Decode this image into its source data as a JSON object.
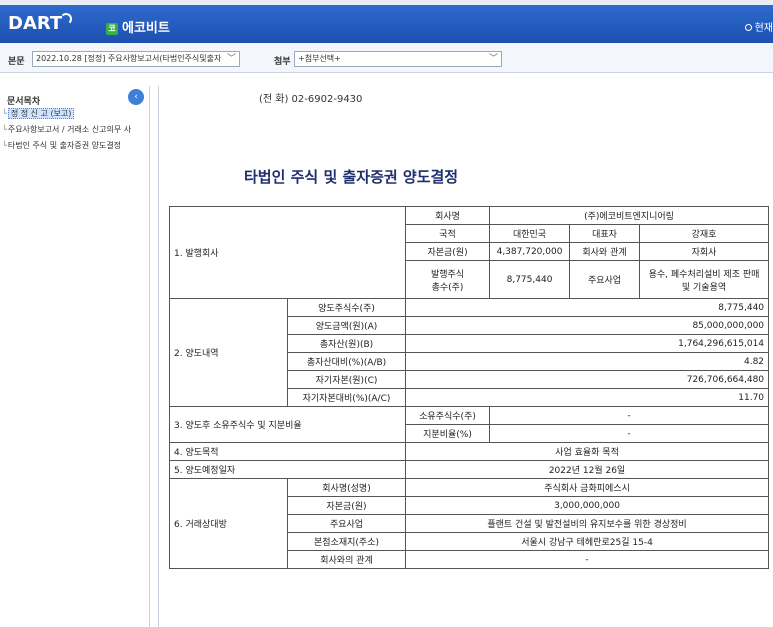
{
  "header": {
    "logo": "DART",
    "company_badge": "코",
    "company": "에코비트",
    "now": "현재"
  },
  "selbar": {
    "body_label": "본문",
    "body_value": "2022.10.28 [정정] 주요사항보고서(타법인주식및출자",
    "attach_label": "첨부",
    "attach_value": "+첨부선택+"
  },
  "sidebar": {
    "title": "문서목차",
    "items": [
      {
        "label": "정 정 신 고 (보고)"
      },
      {
        "label": "주요사항보고서 / 거래소 신고의무 사"
      },
      {
        "label": "타법인 주식 및 출자증권 양도결정"
      }
    ]
  },
  "doc": {
    "phone": "(전  화)  02-6902-9430",
    "title": "타법인 주식 및 출자증권 양도결정",
    "issuer": {
      "section": "1. 발행회사",
      "name_label": "회사명",
      "name_value": "(주)에코비트엔지니어링",
      "country_label": "국적",
      "country_value": "대한민국",
      "ceo_label": "대표자",
      "ceo_value": "강재호",
      "capital_label": "자본금(원)",
      "capital_value": "4,387,720,000",
      "relation_label": "회사와 관계",
      "relation_value": "자회사",
      "shares_label": "발행주식\n총수(주)",
      "shares_value": "8,775,440",
      "business_label": "주요사업",
      "business_value": "용수, 폐수처리설비 제조 판매 및 기술용역"
    },
    "transfer": {
      "section": "2. 양도내역",
      "rows": [
        {
          "label": "양도주식수(주)",
          "value": "8,775,440"
        },
        {
          "label": "양도금액(원)(A)",
          "value": "85,000,000,000"
        },
        {
          "label": "총자산(원)(B)",
          "value": "1,764,296,615,014"
        },
        {
          "label": "총자산대비(%)(A/B)",
          "value": "4.82"
        },
        {
          "label": "자기자본(원)(C)",
          "value": "726,706,664,480"
        },
        {
          "label": "자기자본대비(%)(A/C)",
          "value": "11.70"
        }
      ]
    },
    "after": {
      "section": "3. 양도후 소유주식수 및 지분비율",
      "shares_label": "소유주식수(주)",
      "shares_value": "-",
      "ratio_label": "지분비율(%)",
      "ratio_value": "-"
    },
    "purpose": {
      "section": "4. 양도목적",
      "value": "사업 효율화 목적"
    },
    "date": {
      "section": "5. 양도예정일자",
      "value": "2022년 12월 26일"
    },
    "counterparty": {
      "section": "6. 거래상대방",
      "rows": [
        {
          "label": "회사명(성명)",
          "value": "주식회사 금화피에스시"
        },
        {
          "label": "자본금(원)",
          "value": "3,000,000,000"
        },
        {
          "label": "주요사업",
          "value": "플랜트 건설 및 발전설비의 유지보수를 위한 경상정비"
        },
        {
          "label": "본점소재지(주소)",
          "value": "서울시 강남구 테헤란로25길 15-4"
        },
        {
          "label": "회사와의 관계",
          "value": "-"
        }
      ]
    }
  }
}
